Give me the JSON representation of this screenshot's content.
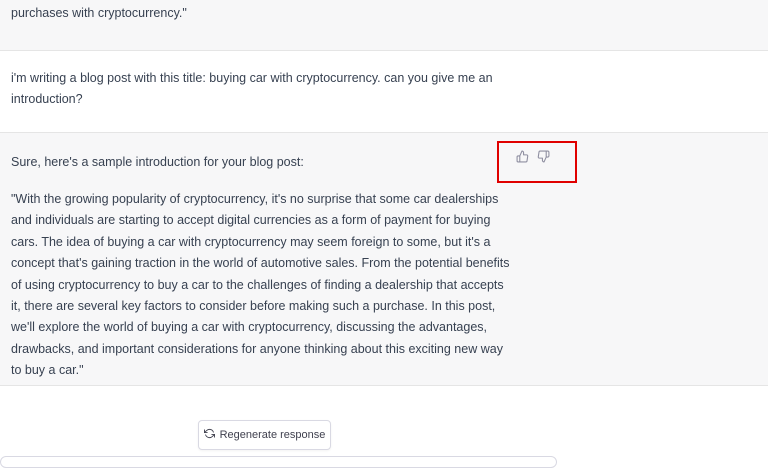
{
  "messages": {
    "prev_fragment": "purchases with cryptocurrency.\"",
    "user_prompt": "i'm writing a blog post with this title: buying car with cryptocurrency. can you give me an introduction?",
    "assistant_intro": "Sure, here's a sample introduction for your blog post:",
    "assistant_body": "\"With the growing popularity of cryptocurrency, it's no surprise that some car dealerships and individuals are starting to accept digital currencies as a form of payment for buying cars. The idea of buying a car with cryptocurrency may seem foreign to some, but it's a concept that's gaining traction in the world of automotive sales. From the potential benefits of using cryptocurrency to buy a car to the challenges of finding a dealership that accepts it, there are several key factors to consider before making such a purchase. In this post, we'll explore the world of buying a car with cryptocurrency, discussing the advantages, drawbacks, and important considerations for anyone thinking about this exciting new way to buy a car.\""
  },
  "feedback": {
    "thumbs_up_icon": "thumbs-up-icon",
    "thumbs_down_icon": "thumbs-down-icon",
    "highlight_color": "#e00000"
  },
  "regenerate": {
    "label": "Regenerate response",
    "icon": "refresh-icon"
  },
  "colors": {
    "assistant_bg": "#f7f7f8",
    "text": "#374151"
  }
}
